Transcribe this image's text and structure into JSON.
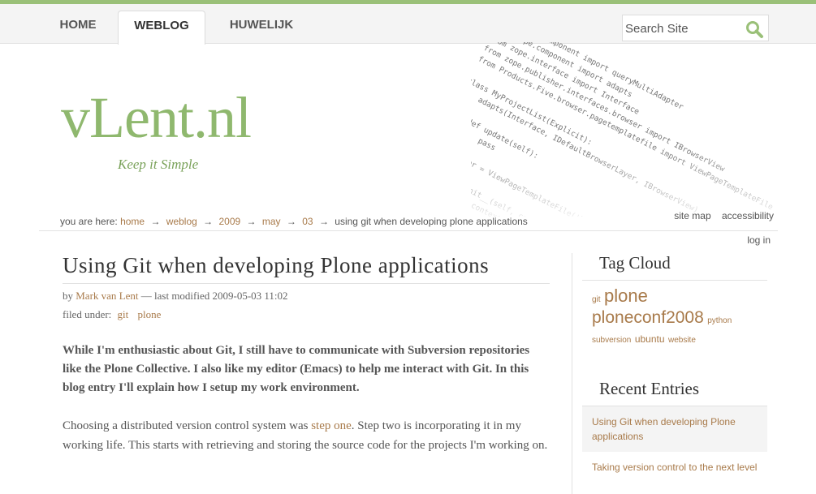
{
  "nav": {
    "tabs": [
      {
        "label": "HOME"
      },
      {
        "label": "WEBLOG"
      },
      {
        "label": "HUWELIJK"
      }
    ],
    "search_placeholder": "Search Site"
  },
  "colors": {
    "accent": "#9ac078",
    "link": "#a87a4a",
    "logo": "#8fb86e"
  },
  "site": {
    "title": "vLent.nl",
    "slogan": "Keep it Simple"
  },
  "breadcrumb": {
    "prefix": "you are here:",
    "items": [
      "home",
      "weblog",
      "2009",
      "may",
      "03"
    ],
    "current": "using git when developing plone applications",
    "separator": "→"
  },
  "sitelinks": {
    "sitemap": "site map",
    "accessibility": "accessibility",
    "login": "log in"
  },
  "article": {
    "title": "Using Git when developing Plone applications",
    "by": "by",
    "author": "Mark van Lent",
    "modified": "— last modified 2009-05-03 11:02",
    "filed_label": "filed under:",
    "tags": [
      "git",
      "plone"
    ],
    "lead": "While I'm enthusiastic about Git, I still have to communicate with Subversion repositories like the Plone Collective. I also like my editor (Emacs) to help me interact with Git. In this blog entry I'll explain how I setup my work environment.",
    "body_before": "Choosing a distributed version control system was ",
    "body_link": "step one",
    "body_after": ". Step two is incorporating it in my working life. This starts with retrieving and storing the source code for the projects I'm working on."
  },
  "sidebar": {
    "tag_cloud_title": "Tag Cloud",
    "tags": [
      {
        "label": "git",
        "size": 10
      },
      {
        "label": "plone",
        "size": 22
      },
      {
        "label": "ploneconf2008",
        "size": 21
      },
      {
        "label": "python",
        "size": 10
      },
      {
        "label": "subversion",
        "size": 10
      },
      {
        "label": "ubuntu",
        "size": 12
      },
      {
        "label": "website",
        "size": 10
      }
    ],
    "recent_title": "Recent Entries",
    "recent": [
      "Using Git when developing Plone applications",
      "Taking version control to the next level"
    ]
  },
  "code_art": "from zope.component import queryMultiAdapter\nfrom zope.component import adapts\nfrom zope.interface import Interface\nfrom zope.publisher.interfaces.browser import IBrowserView\nfrom Products.Five.browser.pagetemplatefile import ViewPageTemplateFile\n\nclass MyProjectList(Explicit):\n    adapts(Interface, IDefaultBrowserLayer, IBrowserView)\n\n    def update(self):\n        pass\n\n    render = ViewPageTemplateFile('list.pt')\n\n    def __init__(self, context, request, view):\n        self.context = context\n        self.request = request"
}
